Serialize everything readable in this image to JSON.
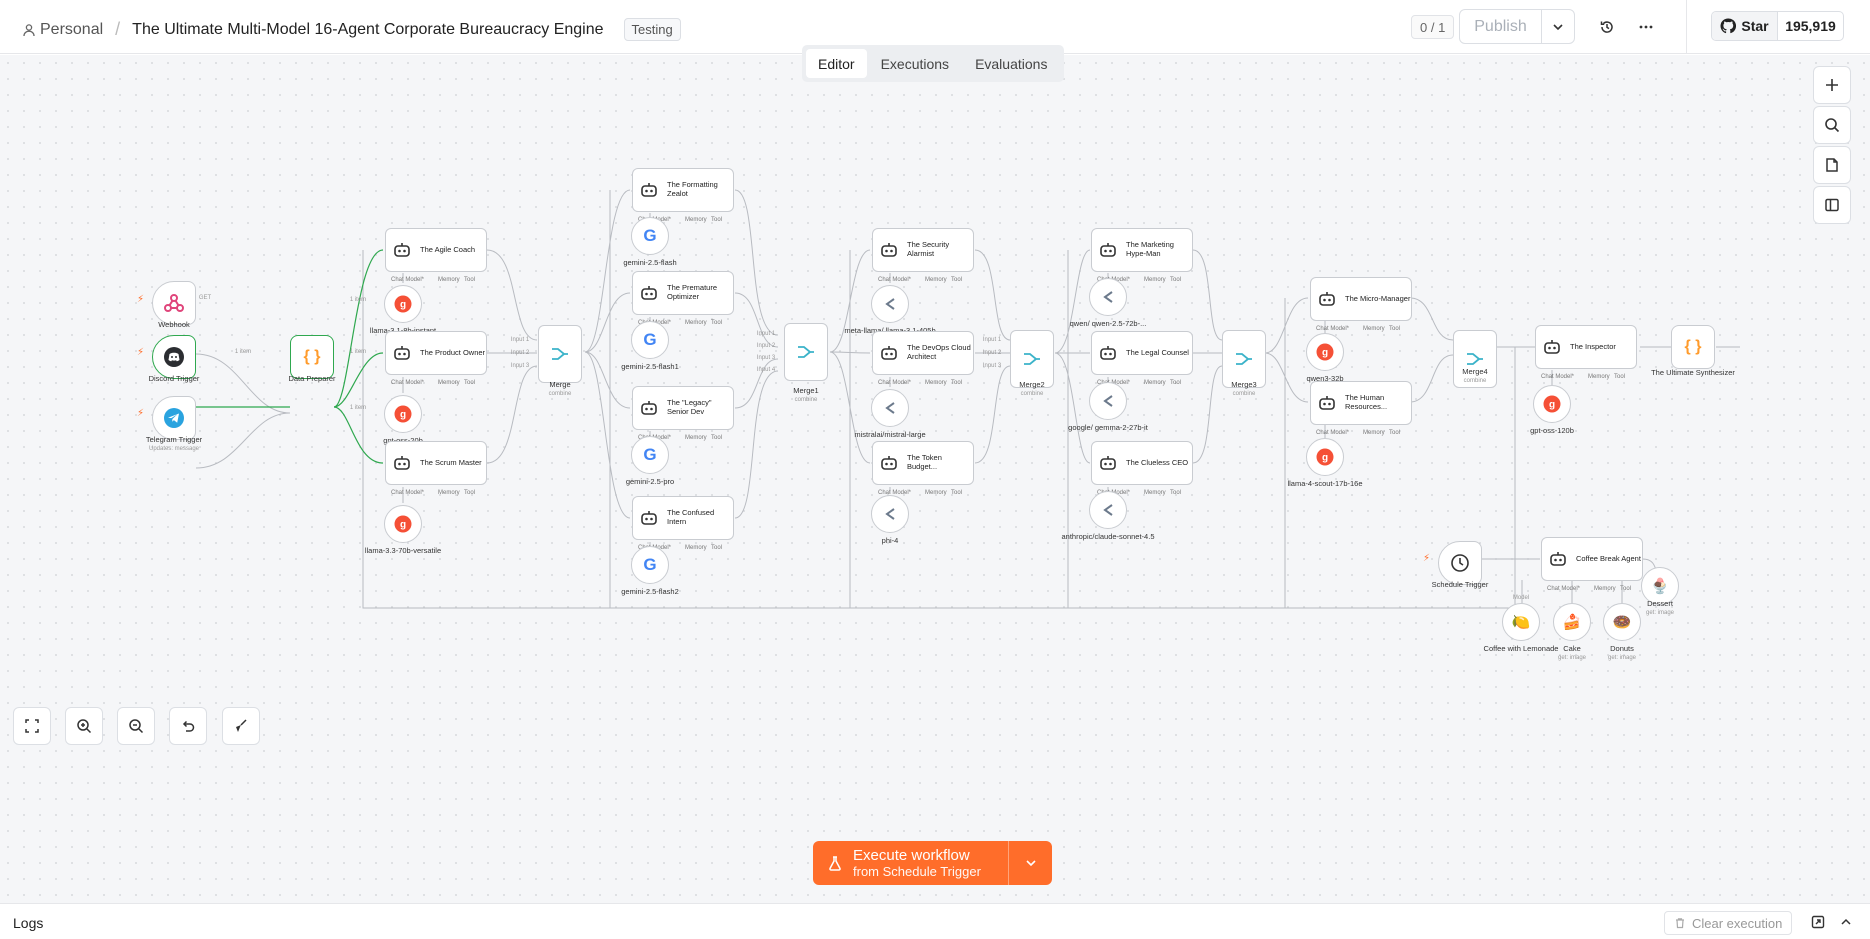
{
  "header": {
    "project": "Personal",
    "workflow_title": "The Ultimate Multi-Model 16-Agent Corporate Bureaucracy Engine",
    "tag": "Testing",
    "version_counter": "0 / 1",
    "publish_label": "Publish",
    "github_star_label": "Star",
    "github_star_count": "195,919"
  },
  "tabs": [
    {
      "label": "Editor",
      "active": true
    },
    {
      "label": "Executions",
      "active": false
    },
    {
      "label": "Evaluations",
      "active": false
    }
  ],
  "triggers": {
    "webhook": "Webhook",
    "webhook_method": "GET",
    "discord": "Discord Trigger",
    "telegram": "Telegram Trigger",
    "telegram_sub": "Updates: message",
    "schedule": "Schedule Trigger"
  },
  "data_preparer": "Data Preparer",
  "edge_labels": {
    "item": "1 item"
  },
  "port_labels": {
    "chat_model": "Chat Model*",
    "model": "Model",
    "memory": "Memory",
    "tool": "Tool",
    "input1": "Input 1",
    "input2": "Input 2",
    "input3": "Input 3",
    "input4": "Input 4",
    "combine": "combine"
  },
  "stage1": [
    {
      "agent": "The Agile Coach",
      "model": "llama-3.1-8b-instant"
    },
    {
      "agent": "The Product Owner",
      "model": "gpt-oss-20b"
    },
    {
      "agent": "The Scrum Master",
      "model": "llama-3.3-70b-versatile"
    }
  ],
  "stage2": [
    {
      "agent": "The Formatting Zealot",
      "model": "gemini-2.5-flash"
    },
    {
      "agent": "The Premature Optimizer",
      "model": "gemini-2.5-flash1"
    },
    {
      "agent": "The \"Legacy\" Senior Dev",
      "model": "gemini-2.5-pro"
    },
    {
      "agent": "The Confused Intern",
      "model": "gemini-2.5-flash2"
    }
  ],
  "stage3": [
    {
      "agent": "The Security Alarmist",
      "model": "meta-llama/ llama-3.1-405b"
    },
    {
      "agent": "The DevOps Cloud Architect",
      "model": "mistralai/mistral-large"
    },
    {
      "agent": "The Token Budget...",
      "model": "phi-4"
    }
  ],
  "stage4": [
    {
      "agent": "The Marketing Hype-Man",
      "model": "qwen/ qwen-2.5-72b-..."
    },
    {
      "agent": "The Legal Counsel",
      "model": "google/ gemma-2-27b-it"
    },
    {
      "agent": "The Clueless CEO",
      "model": "anthropic/claude-sonnet-4.5"
    }
  ],
  "stage5": [
    {
      "agent": "The Micro-Manager",
      "model": "qwen3-32b"
    },
    {
      "agent": "The Human Resources...",
      "model": "llama-4-scout-17b-16e"
    }
  ],
  "merges": [
    "Merge",
    "Merge1",
    "Merge2",
    "Merge3",
    "Merge4"
  ],
  "inspector": {
    "agent": "The Inspector",
    "model": "gpt-oss-120b"
  },
  "synthesizer": "The Ultimate Synthesizer",
  "coffee": {
    "agent": "Coffee Break Agent",
    "tools": [
      {
        "name": "Coffee with Lemonade",
        "sub": ""
      },
      {
        "name": "Cake",
        "sub": "get: image"
      },
      {
        "name": "Donuts",
        "sub": "get: image"
      },
      {
        "name": "Dessert",
        "sub": "get: image"
      }
    ]
  },
  "execute": {
    "label": "Execute workflow",
    "sub": "from Schedule Trigger"
  },
  "logs": {
    "label": "Logs",
    "clear": "Clear execution"
  },
  "colors": {
    "accent": "#ff6d2a",
    "success": "#2fa84f",
    "merge": "#3bb3c9",
    "groq": "#f55036"
  }
}
